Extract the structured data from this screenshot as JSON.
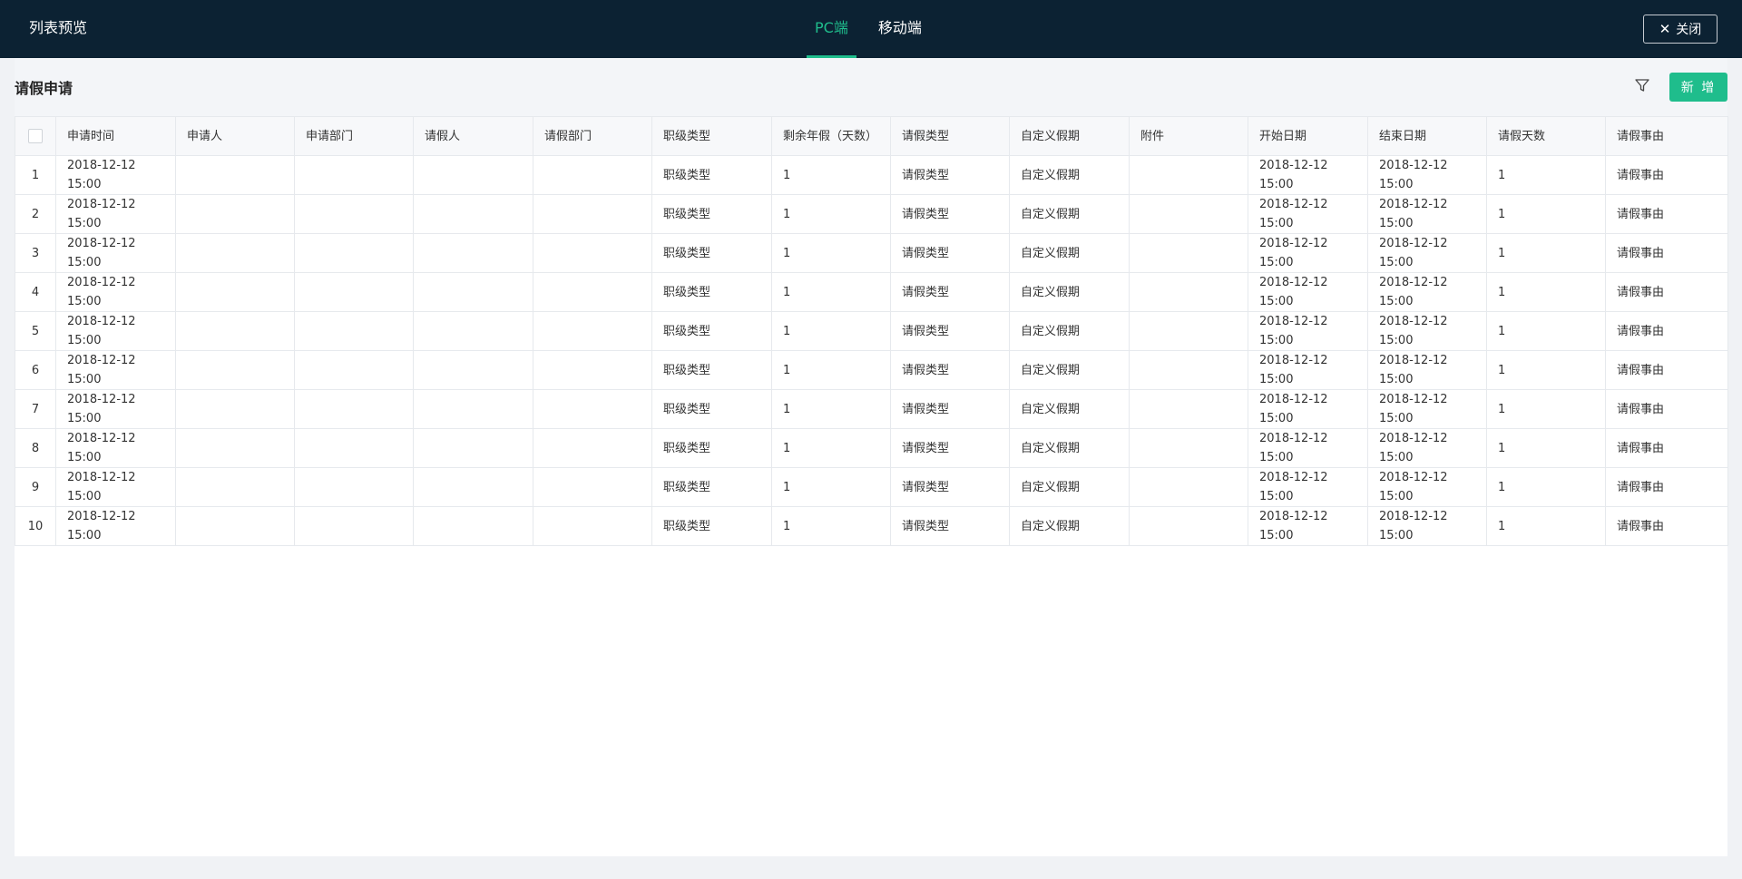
{
  "topbar": {
    "title": "列表预览",
    "tabs": [
      {
        "label": "PC端",
        "active": true
      },
      {
        "label": "移动端",
        "active": false
      }
    ],
    "close_label": "关闭"
  },
  "page": {
    "title": "请假申请",
    "add_label": "新 增"
  },
  "colors": {
    "header_bg": "#0c2233",
    "accent": "#1fbd8c"
  },
  "table": {
    "columns": [
      "申请时间",
      "申请人",
      "申请部门",
      "请假人",
      "请假部门",
      "职级类型",
      "剩余年假（天数）",
      "请假类型",
      "自定义假期",
      "附件",
      "开始日期",
      "结束日期",
      "请假天数",
      "请假事由"
    ],
    "rows": [
      {
        "idx": "1",
        "cells": [
          "2018-12-12 15:00",
          "",
          "",
          "",
          "",
          "职级类型",
          "1",
          "请假类型",
          "自定义假期",
          "",
          "2018-12-12 15:00",
          "2018-12-12 15:00",
          "1",
          "请假事由"
        ]
      },
      {
        "idx": "2",
        "cells": [
          "2018-12-12 15:00",
          "",
          "",
          "",
          "",
          "职级类型",
          "1",
          "请假类型",
          "自定义假期",
          "",
          "2018-12-12 15:00",
          "2018-12-12 15:00",
          "1",
          "请假事由"
        ]
      },
      {
        "idx": "3",
        "cells": [
          "2018-12-12 15:00",
          "",
          "",
          "",
          "",
          "职级类型",
          "1",
          "请假类型",
          "自定义假期",
          "",
          "2018-12-12 15:00",
          "2018-12-12 15:00",
          "1",
          "请假事由"
        ]
      },
      {
        "idx": "4",
        "cells": [
          "2018-12-12 15:00",
          "",
          "",
          "",
          "",
          "职级类型",
          "1",
          "请假类型",
          "自定义假期",
          "",
          "2018-12-12 15:00",
          "2018-12-12 15:00",
          "1",
          "请假事由"
        ]
      },
      {
        "idx": "5",
        "cells": [
          "2018-12-12 15:00",
          "",
          "",
          "",
          "",
          "职级类型",
          "1",
          "请假类型",
          "自定义假期",
          "",
          "2018-12-12 15:00",
          "2018-12-12 15:00",
          "1",
          "请假事由"
        ]
      },
      {
        "idx": "6",
        "cells": [
          "2018-12-12 15:00",
          "",
          "",
          "",
          "",
          "职级类型",
          "1",
          "请假类型",
          "自定义假期",
          "",
          "2018-12-12 15:00",
          "2018-12-12 15:00",
          "1",
          "请假事由"
        ]
      },
      {
        "idx": "7",
        "cells": [
          "2018-12-12 15:00",
          "",
          "",
          "",
          "",
          "职级类型",
          "1",
          "请假类型",
          "自定义假期",
          "",
          "2018-12-12 15:00",
          "2018-12-12 15:00",
          "1",
          "请假事由"
        ]
      },
      {
        "idx": "8",
        "cells": [
          "2018-12-12 15:00",
          "",
          "",
          "",
          "",
          "职级类型",
          "1",
          "请假类型",
          "自定义假期",
          "",
          "2018-12-12 15:00",
          "2018-12-12 15:00",
          "1",
          "请假事由"
        ]
      },
      {
        "idx": "9",
        "cells": [
          "2018-12-12 15:00",
          "",
          "",
          "",
          "",
          "职级类型",
          "1",
          "请假类型",
          "自定义假期",
          "",
          "2018-12-12 15:00",
          "2018-12-12 15:00",
          "1",
          "请假事由"
        ]
      },
      {
        "idx": "10",
        "cells": [
          "2018-12-12 15:00",
          "",
          "",
          "",
          "",
          "职级类型",
          "1",
          "请假类型",
          "自定义假期",
          "",
          "2018-12-12 15:00",
          "2018-12-12 15:00",
          "1",
          "请假事由"
        ]
      }
    ]
  }
}
